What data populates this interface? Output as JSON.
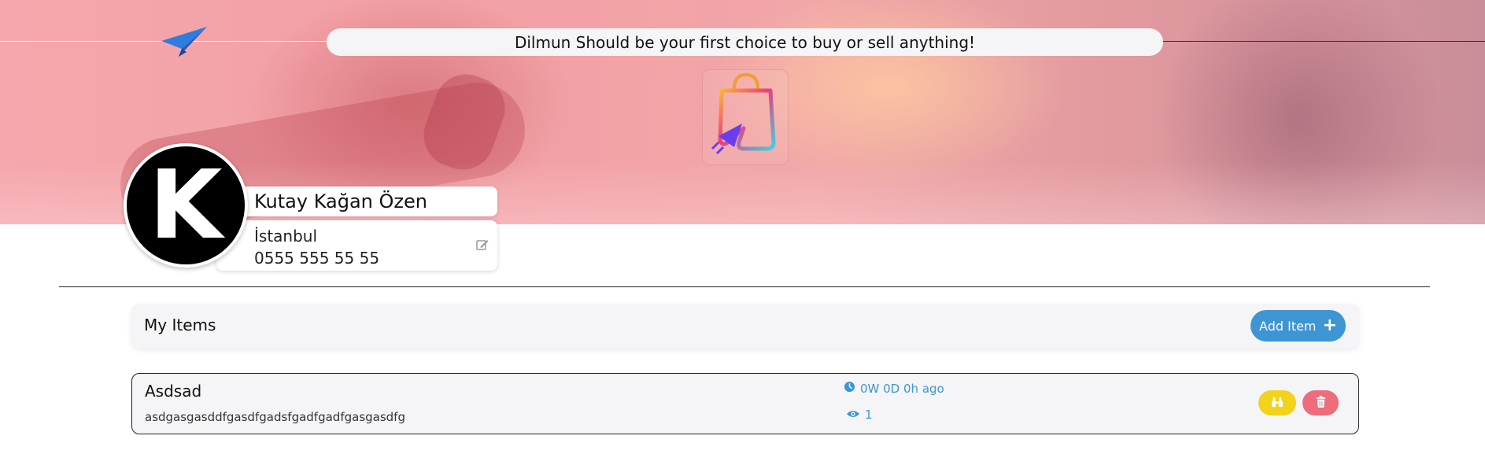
{
  "banner": {
    "tagline": "Dilmun Should be your first choice to buy or sell anything!",
    "brand_icon": "paper-plane-icon",
    "logo_icon": "shopping-bag-cursor-icon"
  },
  "profile": {
    "initial": "K",
    "name": "Kutay Kağan Özen",
    "city": "İstanbul",
    "phone": "0555 555 55 55",
    "edit_icon": "edit-icon"
  },
  "items_section": {
    "title": "My Items",
    "add_button_label": "Add Item",
    "add_icon": "plus-icon"
  },
  "items": [
    {
      "name": "Asdsad",
      "description": "asdgasgasddfgasdfgadsfgadfgadfgasgasdfg",
      "time_ago": "0W 0D 0h ago",
      "views": "1",
      "time_icon": "clock-icon",
      "views_icon": "eye-icon",
      "view_icon": "binoculars-icon",
      "delete_icon": "trash-icon"
    }
  ],
  "colors": {
    "accent_blue": "#3e95d4",
    "view_yellow": "#f2d31b",
    "delete_red": "#ee6c7c",
    "panel_bg": "#f5f5f7"
  }
}
